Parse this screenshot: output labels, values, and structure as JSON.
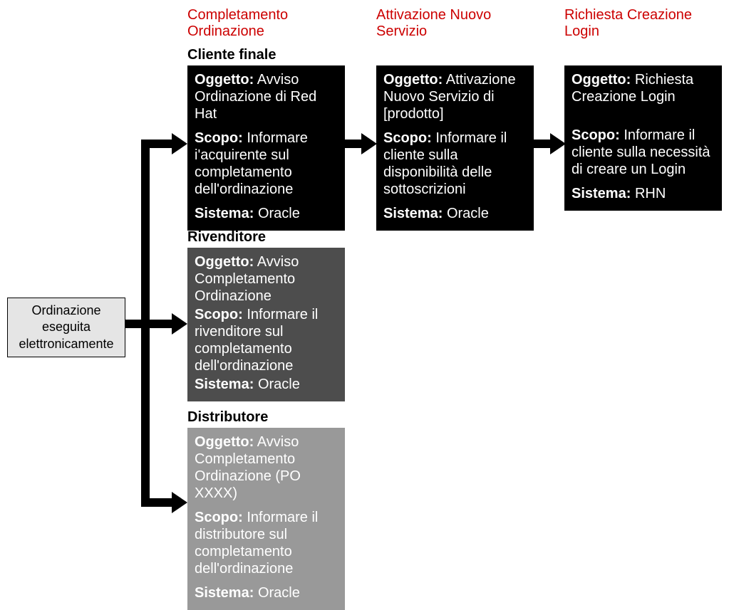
{
  "columns": {
    "col1": "Completamento Ordinazione",
    "col2": "Attivazione Nuovo Servizio",
    "col3": "Richiesta Creazione Login"
  },
  "subheaders": {
    "clienteFinale": "Cliente finale",
    "rivenditore": "Rivenditore",
    "distributore": "Distributore"
  },
  "start": {
    "line1": "Ordinazione",
    "line2": "eseguita",
    "line3": "elettronicamente"
  },
  "labels": {
    "oggetto": "Oggetto:",
    "scopo": "Scopo:",
    "sistema": "Sistema:"
  },
  "cards": {
    "cf1": {
      "oggetto": "Avviso Ordinazione di Red Hat",
      "scopo": "Informare i'acquirente sul completamento dell'ordinazione",
      "sistema": "Oracle"
    },
    "cf2": {
      "oggetto": "Attivazione Nuovo Servizio di [prodotto]",
      "scopo": "Informare il cliente sulla disponibilità delle sottoscrizioni",
      "sistema": "Oracle"
    },
    "cf3": {
      "oggetto": "Richiesta Creazione Login",
      "scopo": "Informare il cliente sulla necessità di creare un Login",
      "sistema": "RHN"
    },
    "riv": {
      "oggetto": "Avviso Completamento Ordinazione",
      "scopo": "Informare il rivenditore sul completamento dell'ordinazione",
      "sistema": "Oracle"
    },
    "dist": {
      "oggetto": "Avviso Completamento Ordinazione (PO XXXX)",
      "scopo": "Informare il distributore sul completamento dell'ordinazione",
      "sistema": "Oracle"
    }
  }
}
